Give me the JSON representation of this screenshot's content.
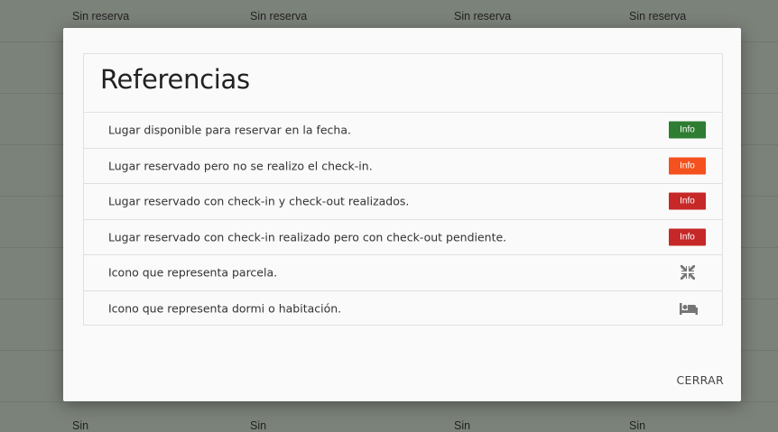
{
  "background": {
    "top_row": [
      "Sin reserva",
      "Sin reserva",
      "Sin reserva",
      "Sin reserva"
    ],
    "bottom_row": [
      "Sin",
      "Sin",
      "Sin",
      "Sin"
    ]
  },
  "modal": {
    "title": "Referencias",
    "items": [
      {
        "text": "Lugar disponible para reservar en la fecha.",
        "badge": "Info",
        "badge_color": "#2e7d32"
      },
      {
        "text": "Lugar reservado pero no se realizo el check-in.",
        "badge": "Info",
        "badge_color": "#f4511e"
      },
      {
        "text": "Lugar reservado con check-in y check-out realizados.",
        "badge": "Info",
        "badge_color": "#c62828"
      },
      {
        "text": "Lugar reservado con check-in realizado pero con check-out pendiente.",
        "badge": "Info",
        "badge_color": "#c62828"
      },
      {
        "text": "Icono que representa parcela.",
        "icon": "compress-arrows-icon"
      },
      {
        "text": "Icono que representa dormi o habitación.",
        "icon": "bed-icon"
      }
    ],
    "close_label": "CERRAR"
  }
}
